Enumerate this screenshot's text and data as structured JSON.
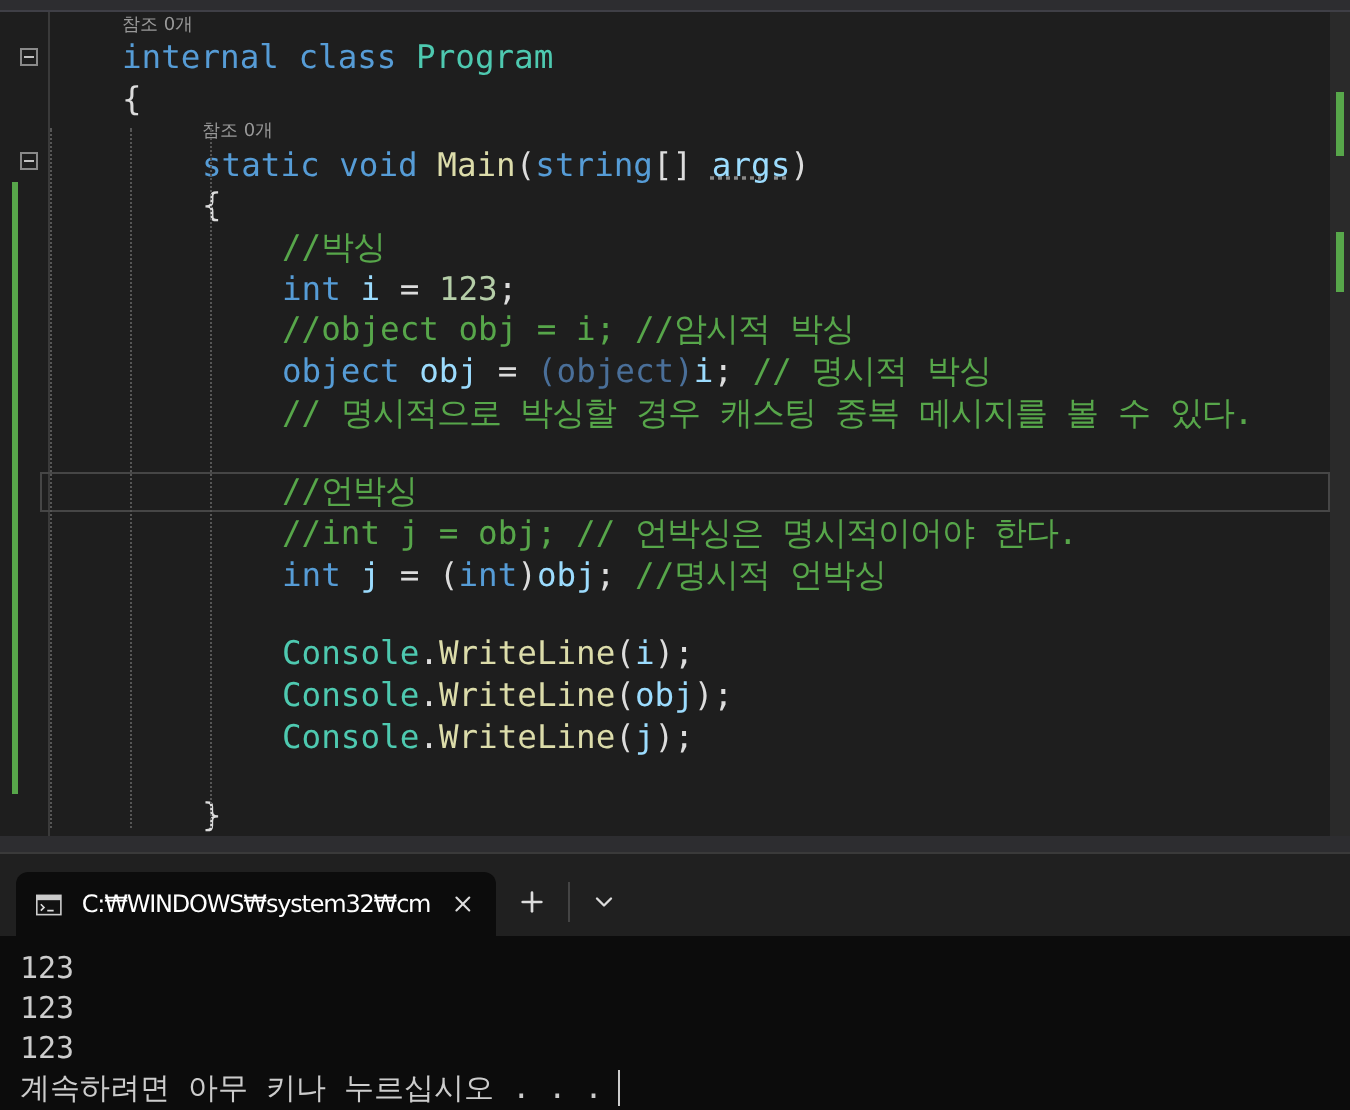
{
  "editor": {
    "lines": [
      {
        "kind": "codelens",
        "text": "참조 0개"
      },
      {
        "kind": "code",
        "fold": true,
        "tokens": [
          {
            "kind": "keyword",
            "text": "internal class "
          },
          {
            "kind": "type",
            "text": "Program"
          }
        ]
      },
      {
        "kind": "code",
        "tokens": [
          {
            "kind": "plain",
            "text": "{"
          }
        ],
        "children": [
          {
            "kind": "codelens",
            "text": "참조 0개"
          },
          {
            "kind": "code",
            "fold": true,
            "tokens": [
              {
                "kind": "keyword",
                "text": "static void "
              },
              {
                "kind": "method",
                "text": "Main"
              },
              {
                "kind": "plain",
                "text": "("
              },
              {
                "kind": "keyword",
                "text": "string"
              },
              {
                "kind": "plain",
                "text": "[] "
              },
              {
                "kind": "unused",
                "text": "args"
              },
              {
                "kind": "plain",
                "text": ")"
              }
            ]
          },
          {
            "kind": "code",
            "changed": true,
            "tokens": [
              {
                "kind": "plain",
                "text": "{"
              }
            ],
            "children": [
              {
                "kind": "code",
                "changed": true,
                "tokens": [
                  {
                    "kind": "comment",
                    "text": "//박싱"
                  }
                ]
              },
              {
                "kind": "code",
                "changed": true,
                "tokens": [
                  {
                    "kind": "keyword",
                    "text": "int "
                  },
                  {
                    "kind": "variable",
                    "text": "i"
                  },
                  {
                    "kind": "plain",
                    "text": " = "
                  },
                  {
                    "kind": "number",
                    "text": "123"
                  },
                  {
                    "kind": "plain",
                    "text": ";"
                  }
                ]
              },
              {
                "kind": "code",
                "changed": true,
                "tokens": [
                  {
                    "kind": "comment",
                    "text": "//object obj = i; //암시적 박싱"
                  }
                ]
              },
              {
                "kind": "code",
                "changed": true,
                "tokens": [
                  {
                    "kind": "keyword",
                    "text": "object "
                  },
                  {
                    "kind": "variable",
                    "text": "obj"
                  },
                  {
                    "kind": "plain",
                    "text": " = "
                  },
                  {
                    "kind": "faded",
                    "text": "(object)"
                  },
                  {
                    "kind": "variable",
                    "text": "i"
                  },
                  {
                    "kind": "plain",
                    "text": "; "
                  },
                  {
                    "kind": "comment",
                    "text": "// 명시적 박싱"
                  }
                ]
              },
              {
                "kind": "code",
                "changed": true,
                "tokens": [
                  {
                    "kind": "comment",
                    "text": "// 명시적으로 박싱할 경우 캐스팅 중복 메시지를 볼 수 있다."
                  }
                ]
              },
              {
                "kind": "code",
                "changed": true
              },
              {
                "kind": "code",
                "changed": true,
                "current": true,
                "tokens": [
                  {
                    "kind": "comment",
                    "text": "//언박싱"
                  }
                ]
              },
              {
                "kind": "code",
                "changed": true,
                "tokens": [
                  {
                    "kind": "comment",
                    "text": "//int j = obj; // 언박싱은 명시적이어야 한다."
                  }
                ]
              },
              {
                "kind": "code",
                "changed": true,
                "tokens": [
                  {
                    "kind": "keyword",
                    "text": "int "
                  },
                  {
                    "kind": "variable",
                    "text": "j"
                  },
                  {
                    "kind": "plain",
                    "text": " = ("
                  },
                  {
                    "kind": "keyword",
                    "text": "int"
                  },
                  {
                    "kind": "plain",
                    "text": ")"
                  },
                  {
                    "kind": "variable",
                    "text": "obj"
                  },
                  {
                    "kind": "plain",
                    "text": "; "
                  },
                  {
                    "kind": "comment",
                    "text": "//명시적 언박싱"
                  }
                ]
              },
              {
                "kind": "code",
                "changed": true
              },
              {
                "kind": "code",
                "changed": true,
                "tokens": [
                  {
                    "kind": "type",
                    "text": "Console"
                  },
                  {
                    "kind": "plain",
                    "text": "."
                  },
                  {
                    "kind": "method",
                    "text": "WriteLine"
                  },
                  {
                    "kind": "plain",
                    "text": "("
                  },
                  {
                    "kind": "variable",
                    "text": "i"
                  },
                  {
                    "kind": "plain",
                    "text": ");"
                  }
                ]
              },
              {
                "kind": "code",
                "changed": true,
                "tokens": [
                  {
                    "kind": "type",
                    "text": "Console"
                  },
                  {
                    "kind": "plain",
                    "text": "."
                  },
                  {
                    "kind": "method",
                    "text": "WriteLine"
                  },
                  {
                    "kind": "plain",
                    "text": "("
                  },
                  {
                    "kind": "variable",
                    "text": "obj"
                  },
                  {
                    "kind": "plain",
                    "text": ");"
                  }
                ]
              },
              {
                "kind": "code",
                "changed": true,
                "tokens": [
                  {
                    "kind": "type",
                    "text": "Console"
                  },
                  {
                    "kind": "plain",
                    "text": "."
                  },
                  {
                    "kind": "method",
                    "text": "WriteLine"
                  },
                  {
                    "kind": "plain",
                    "text": "("
                  },
                  {
                    "kind": "variable",
                    "text": "j"
                  },
                  {
                    "kind": "plain",
                    "text": ");"
                  }
                ]
              },
              {
                "kind": "code",
                "changed": true
              }
            ]
          },
          {
            "kind": "code",
            "tokens": [
              {
                "kind": "plain",
                "text": "}"
              }
            ]
          }
        ]
      }
    ]
  },
  "terminal": {
    "tabs": [
      {
        "title": "C:₩WINDOWS₩system32₩cm",
        "selected": true
      }
    ],
    "output": [
      "123",
      "123",
      "123"
    ],
    "prompt": "계속하려면 아무 키나 누르십시오 . . ."
  }
}
